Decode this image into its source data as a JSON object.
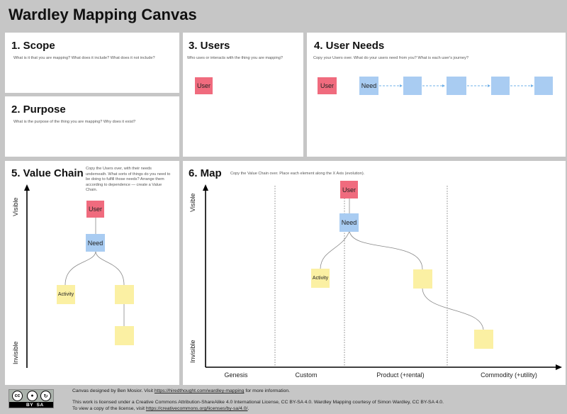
{
  "title": "Wardley Mapping Canvas",
  "scope": {
    "heading": "1. Scope",
    "desc": "What is it that you are mapping? What does it include? What does it not include?"
  },
  "purpose": {
    "heading": "2. Purpose",
    "desc": "What is the purpose of the thing you are mapping? Why does it exist?"
  },
  "users": {
    "heading": "3. Users",
    "desc": "Who uses or interacts with the thing you are mapping?",
    "note": "User"
  },
  "user_needs": {
    "heading": "4. User Needs",
    "desc": "Copy your Users over. What do your users need from you? What is each user's journey?",
    "user_note": "User",
    "need_note": "Need"
  },
  "value_chain": {
    "heading": "5. Value Chain",
    "desc": "Copy the Users over, with their needs underneath. What sorts of things do you need to be doing to fulfill those needs? Arrange them according to dependence — create a Value Chain.",
    "axis_top": "Visible",
    "axis_bottom": "Invisible",
    "user_note": "User",
    "need_note": "Need",
    "activity_note": "Activity"
  },
  "map": {
    "heading": "6. Map",
    "desc": "Copy the Value Chain over. Place each element along the X Axis (evolution).",
    "axis_top": "Visible",
    "axis_bottom": "Invisible",
    "user_note": "User",
    "need_note": "Need",
    "activity_note": "Activity",
    "evolution": [
      "Genesis",
      "Custom",
      "Product (+rental)",
      "Commodity (+utility)"
    ]
  },
  "footer": {
    "cc_by": "BY",
    "cc_sa": "SA",
    "line1_pre": "Canvas designed by Ben Mosior. Visit ",
    "line1_link": "https://hiredthought.com/wardley-mapping",
    "line1_post": " for more information.",
    "line2": "This work is licensed under a Creative Commons Attribution-ShareAlike 4.0 International License, CC BY-SA 4.0. Wardley Mapping courtesy of Simon Wardley, CC BY-SA 4.0.",
    "line3_pre": "To view a copy of the license, visit ",
    "line3_link": "https://creativecommons.org/licenses/by-sa/4.0/",
    "line3_post": "."
  },
  "colors": {
    "user_pink": "#f06b7e",
    "need_blue": "#a9ccf2",
    "activity_yellow": "#fbf0a3",
    "background": "#c6c6c6"
  }
}
